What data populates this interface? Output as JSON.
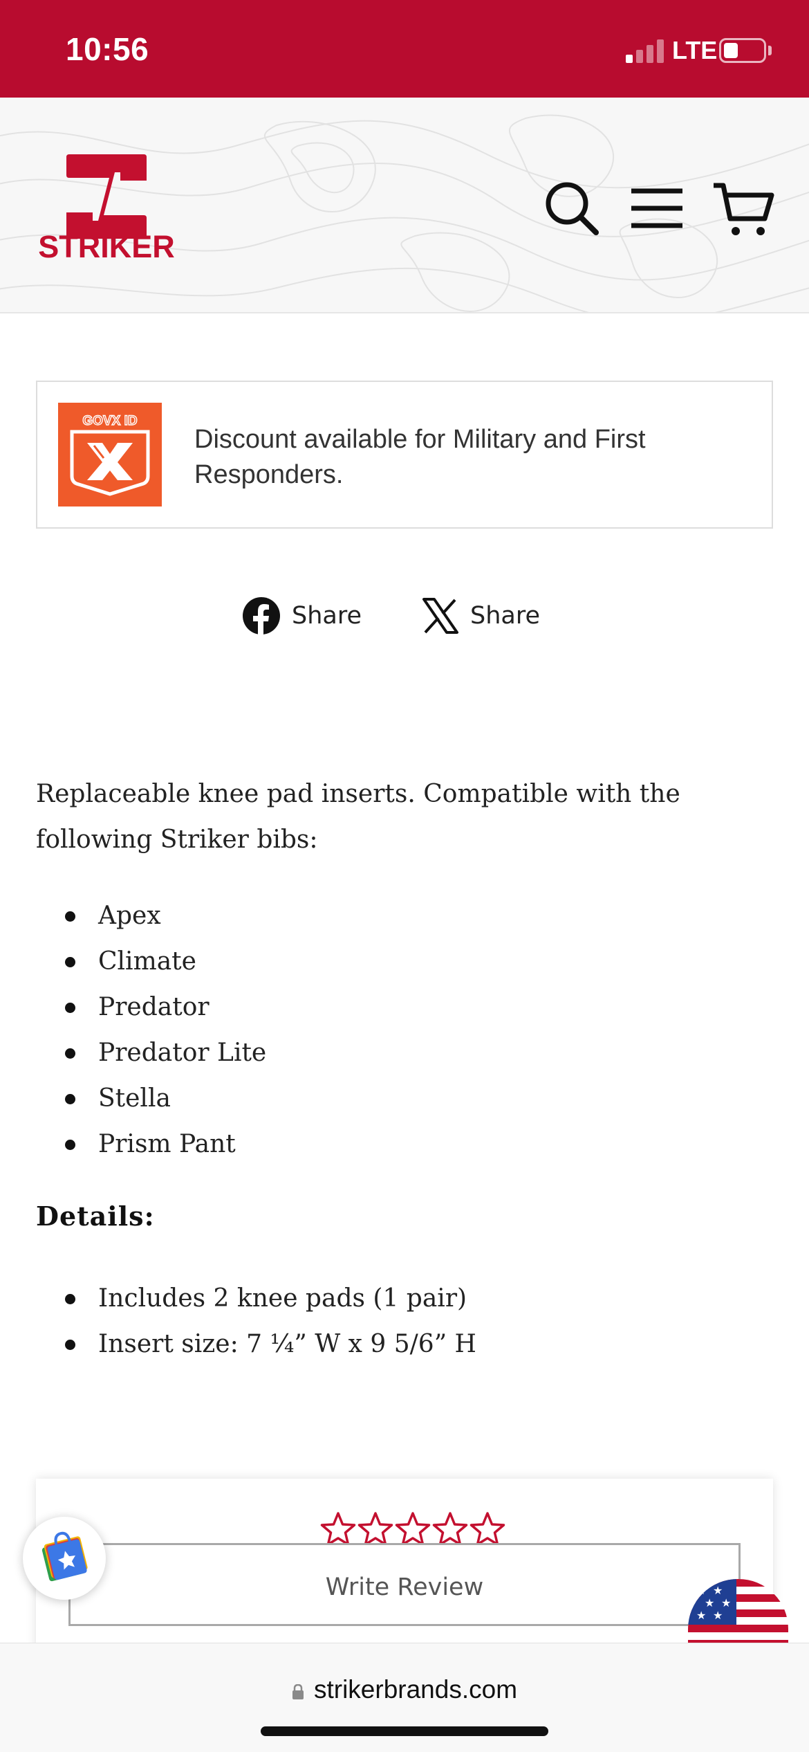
{
  "status_bar": {
    "time": "10:56",
    "network": "LTE",
    "background": "#b80c2f"
  },
  "header": {
    "logo_text": "STRIKER",
    "icons": [
      "search-icon",
      "menu-icon",
      "cart-icon"
    ],
    "brand_color": "#c3102f"
  },
  "govx": {
    "logo_label": "GOVX ID",
    "text": "Discount available for Military and First Responders.",
    "brand_color": "#ef5a2a"
  },
  "share": {
    "facebook_label": "Share",
    "x_label": "Share"
  },
  "description": {
    "intro": "Replaceable knee pad inserts. Compatible with the following Striker bibs:",
    "compatible": [
      "Apex",
      "Climate",
      "Predator",
      "Predator Lite",
      "Stella",
      "Prism Pant"
    ],
    "details_heading": "Details:",
    "details": [
      "Includes 2 knee pads (1 pair)",
      "Insert size: 7 ¼” W x 9 5/6” H"
    ]
  },
  "reviews": {
    "rating": 0,
    "max_rating": 5,
    "write_review_label": "Write Review",
    "star_color": "#c3102f"
  },
  "browser": {
    "url": "strikerbrands.com"
  }
}
